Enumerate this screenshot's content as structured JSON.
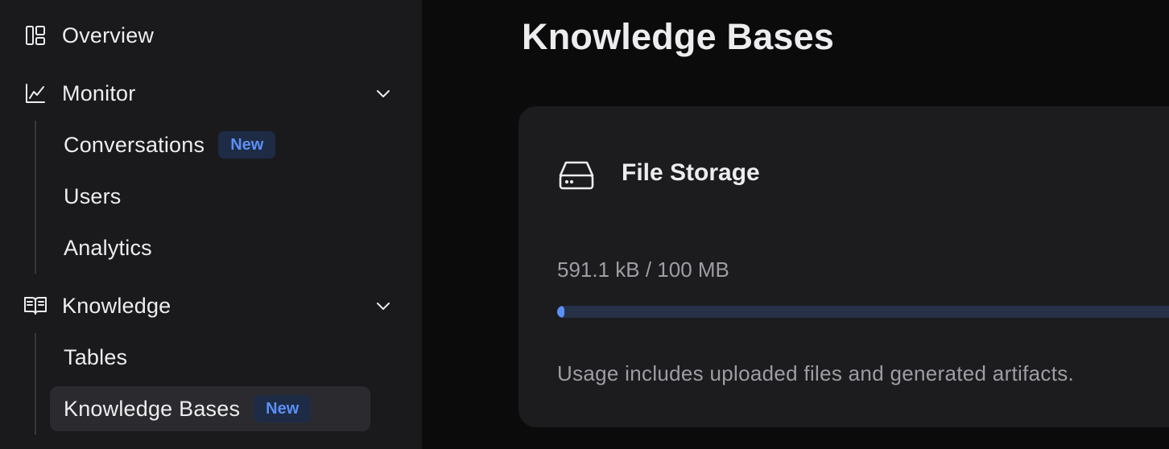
{
  "sidebar": {
    "overview": {
      "label": "Overview",
      "icon": "layout-panels-icon"
    },
    "monitor": {
      "label": "Monitor",
      "icon": "line-chart-icon",
      "items": [
        {
          "label": "Conversations",
          "badge": "New"
        },
        {
          "label": "Users"
        },
        {
          "label": "Analytics"
        }
      ]
    },
    "knowledge": {
      "label": "Knowledge",
      "icon": "book-open-icon",
      "items": [
        {
          "label": "Tables"
        },
        {
          "label": "Knowledge Bases",
          "badge": "New",
          "active": true
        }
      ]
    }
  },
  "main": {
    "title": "Knowledge Bases",
    "storage_card": {
      "icon": "hard-drive-icon",
      "title": "File Storage",
      "usage": "591.1 kB / 100 MB",
      "usage_fraction": 0.005911,
      "note": "Usage includes uploaded files and generated artifacts."
    }
  },
  "colors": {
    "accent": "#5b8ff3",
    "badge_bg": "#1e2b45",
    "sidebar_bg": "#1a1a1d",
    "main_bg": "#0b0b0c",
    "card_bg": "#1c1c1f"
  }
}
